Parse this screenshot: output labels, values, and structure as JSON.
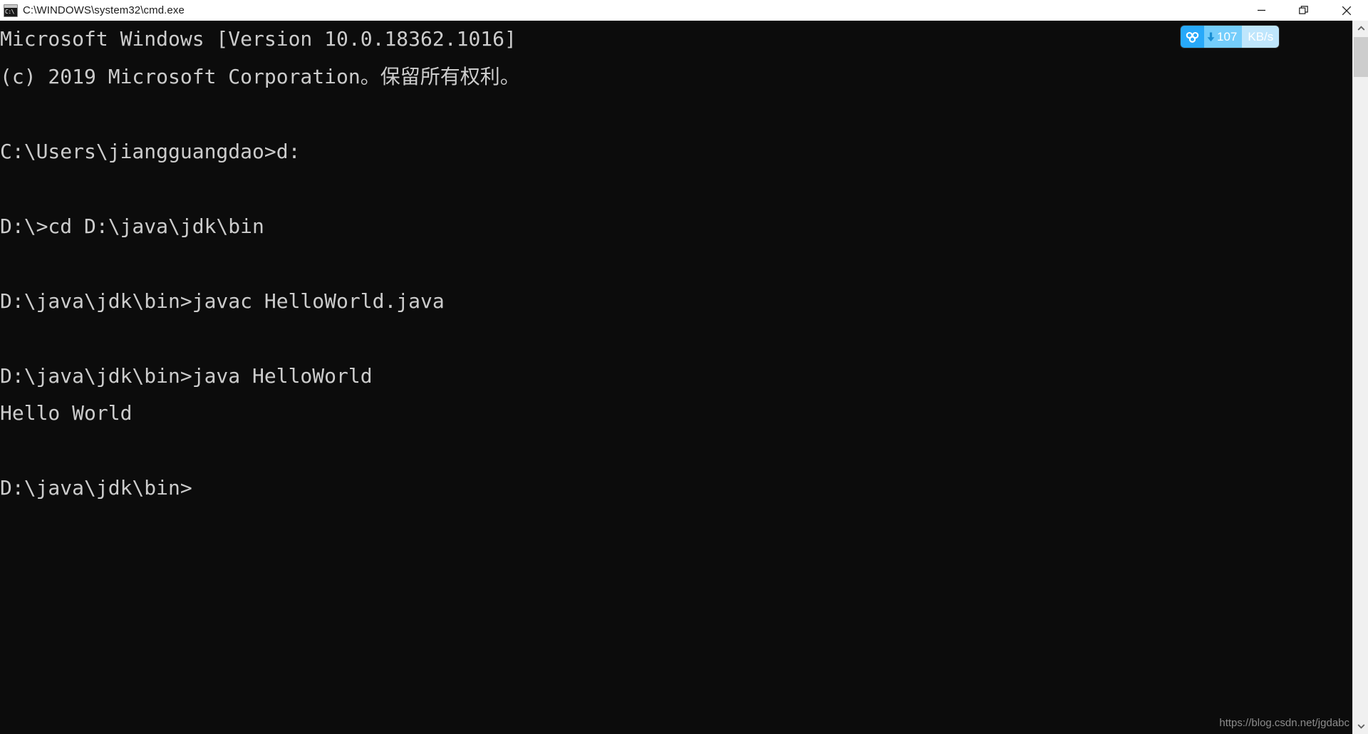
{
  "window": {
    "title": "C:\\WINDOWS\\system32\\cmd.exe",
    "icon": "cmd-console-icon",
    "icon_prompt": "C:\\",
    "background_color": "#0c0c0c",
    "titlebar_color": "#ffffff",
    "text_color": "#cccccc"
  },
  "window_controls": {
    "minimize_label": "Minimize",
    "restore_label": "Restore",
    "close_label": "Close"
  },
  "console": {
    "lines": [
      "Microsoft Windows [Version 10.0.18362.1016]",
      "(c) 2019 Microsoft Corporation。保留所有权利。",
      "",
      "C:\\Users\\jiangguangdao>d:",
      "",
      "D:\\>cd D:\\java\\jdk\\bin",
      "",
      "D:\\java\\jdk\\bin>javac HelloWorld.java",
      "",
      "D:\\java\\jdk\\bin>java HelloWorld",
      "Hello World",
      "",
      "D:\\java\\jdk\\bin>"
    ]
  },
  "net_badge": {
    "icon": "baidu-netdisk-cloud-icon",
    "direction_icon": "download-arrow-icon",
    "value": "107",
    "unit": "KB/s",
    "icon_bg": "#28a9fa",
    "rate_bg": "#74cdfb",
    "unit_bg": "#bfe6fc"
  },
  "watermark": {
    "text": "https://blog.csdn.net/jgdabc"
  },
  "scrollbar": {
    "up_arrow": "chevron-up-icon",
    "down_arrow": "chevron-down-icon",
    "thumb_label": "scrollbar-thumb"
  }
}
